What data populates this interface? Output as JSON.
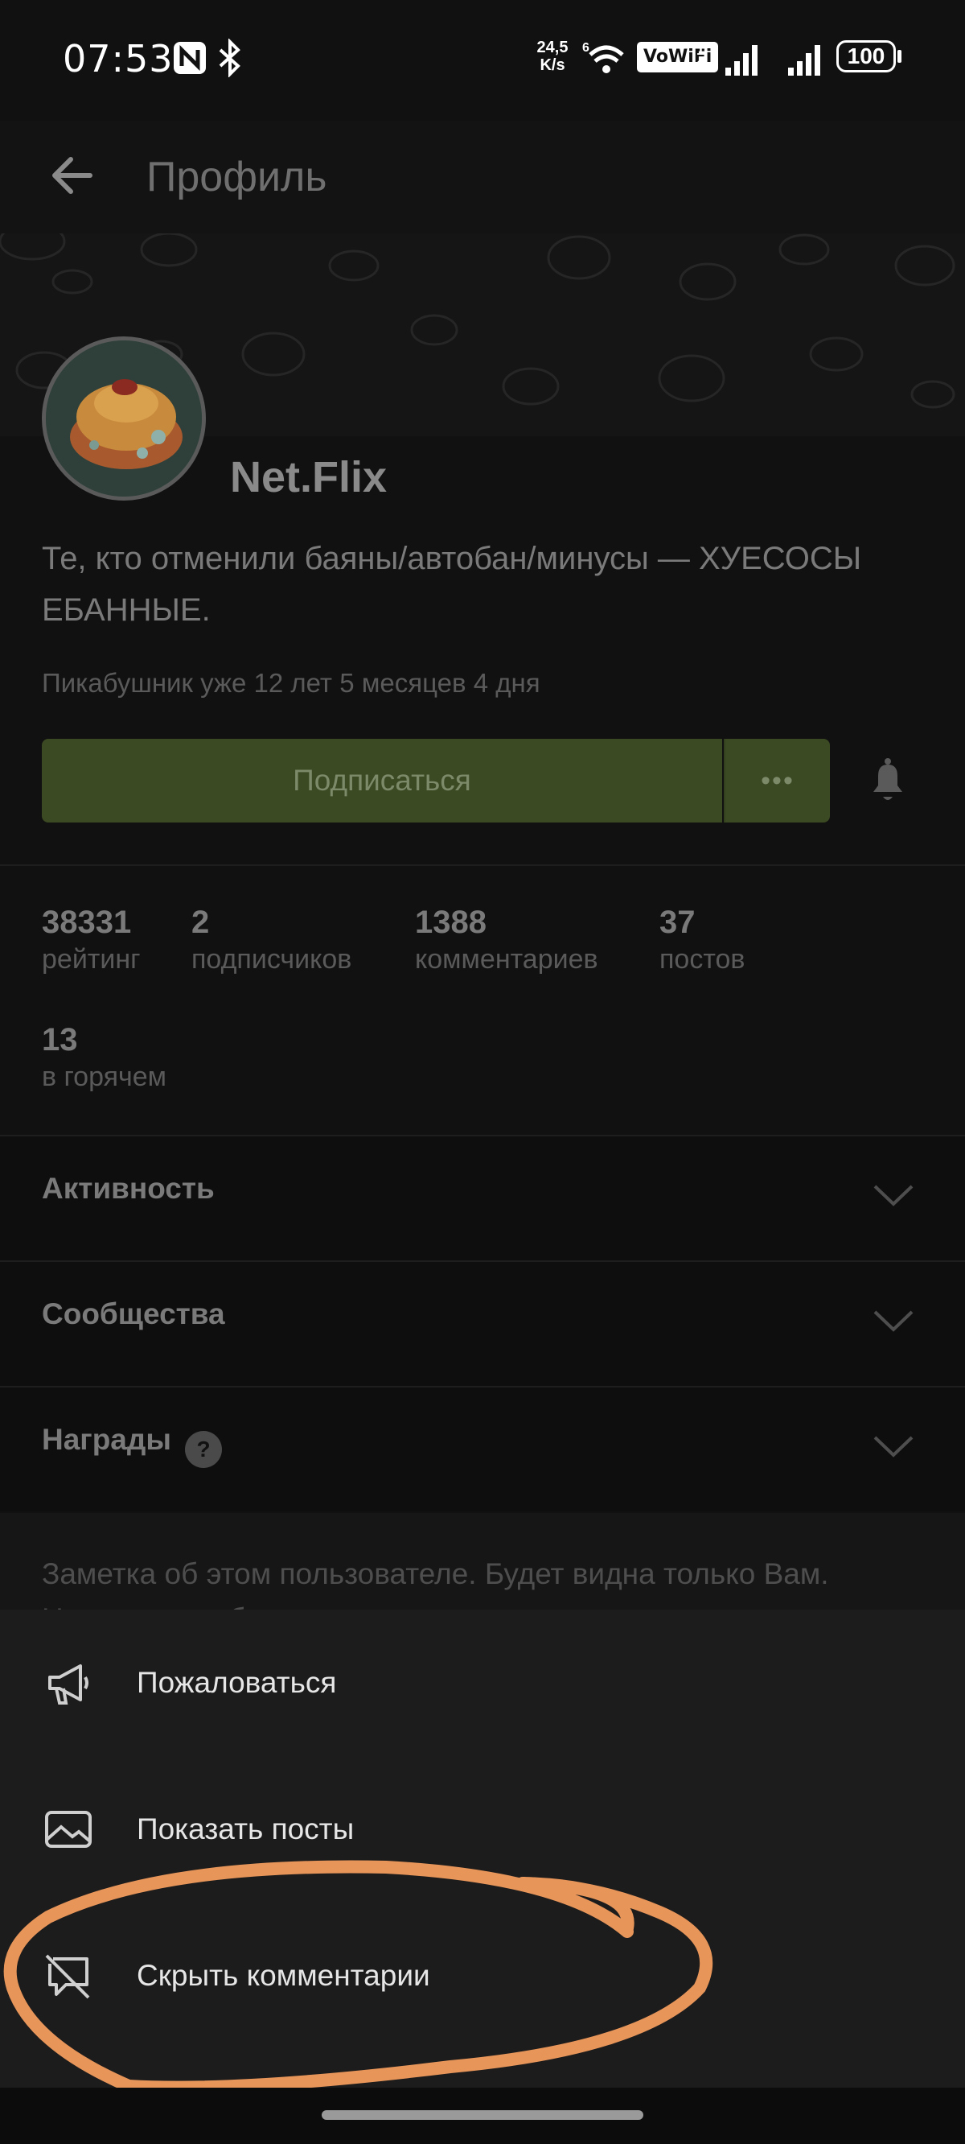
{
  "status_bar": {
    "time": "07:53",
    "speed": "24,5",
    "speed_unit": "K/s",
    "vowifi": "VoWiFi",
    "battery": "100",
    "icons": [
      "nfc-icon",
      "bluetooth-icon",
      "wifi-icon",
      "signal-icon",
      "signal-icon",
      "battery-icon"
    ]
  },
  "header": {
    "title": "Профиль"
  },
  "profile": {
    "username": "Net.Flix",
    "bio": "Те, кто отменили баяны/автобан/минусы — ХУЕСОСЫ ЕБАННЫЕ.",
    "tenure": "Пикабушник уже 12 лет 5 месяцев 4 дня",
    "subscribe_label": "Подписаться",
    "more_label": "•••"
  },
  "stats": [
    {
      "value": "38331",
      "label": "рейтинг"
    },
    {
      "value": "2",
      "label": "подписчиков"
    },
    {
      "value": "1388",
      "label": "комментариев"
    },
    {
      "value": "37",
      "label": "постов"
    },
    {
      "value": "13",
      "label": "в горячем"
    }
  ],
  "sections": [
    {
      "title": "Активность"
    },
    {
      "title": "Сообщества"
    },
    {
      "title": "Награды"
    }
  ],
  "note": {
    "placeholder": "Заметка об этом пользователе. Будет видна только Вам. Нажмите, чтобы ввести текст."
  },
  "menu": [
    {
      "label": "Пожаловаться",
      "icon": "megaphone-icon"
    },
    {
      "label": "Показать посты",
      "icon": "image-icon"
    },
    {
      "label": "Скрыть комментарии",
      "icon": "comment-off-icon"
    }
  ],
  "colors": {
    "background": "#111111",
    "accent_green": "#3b4a23",
    "annotation": "#e8955a",
    "sheet": "#1c1c1c"
  }
}
